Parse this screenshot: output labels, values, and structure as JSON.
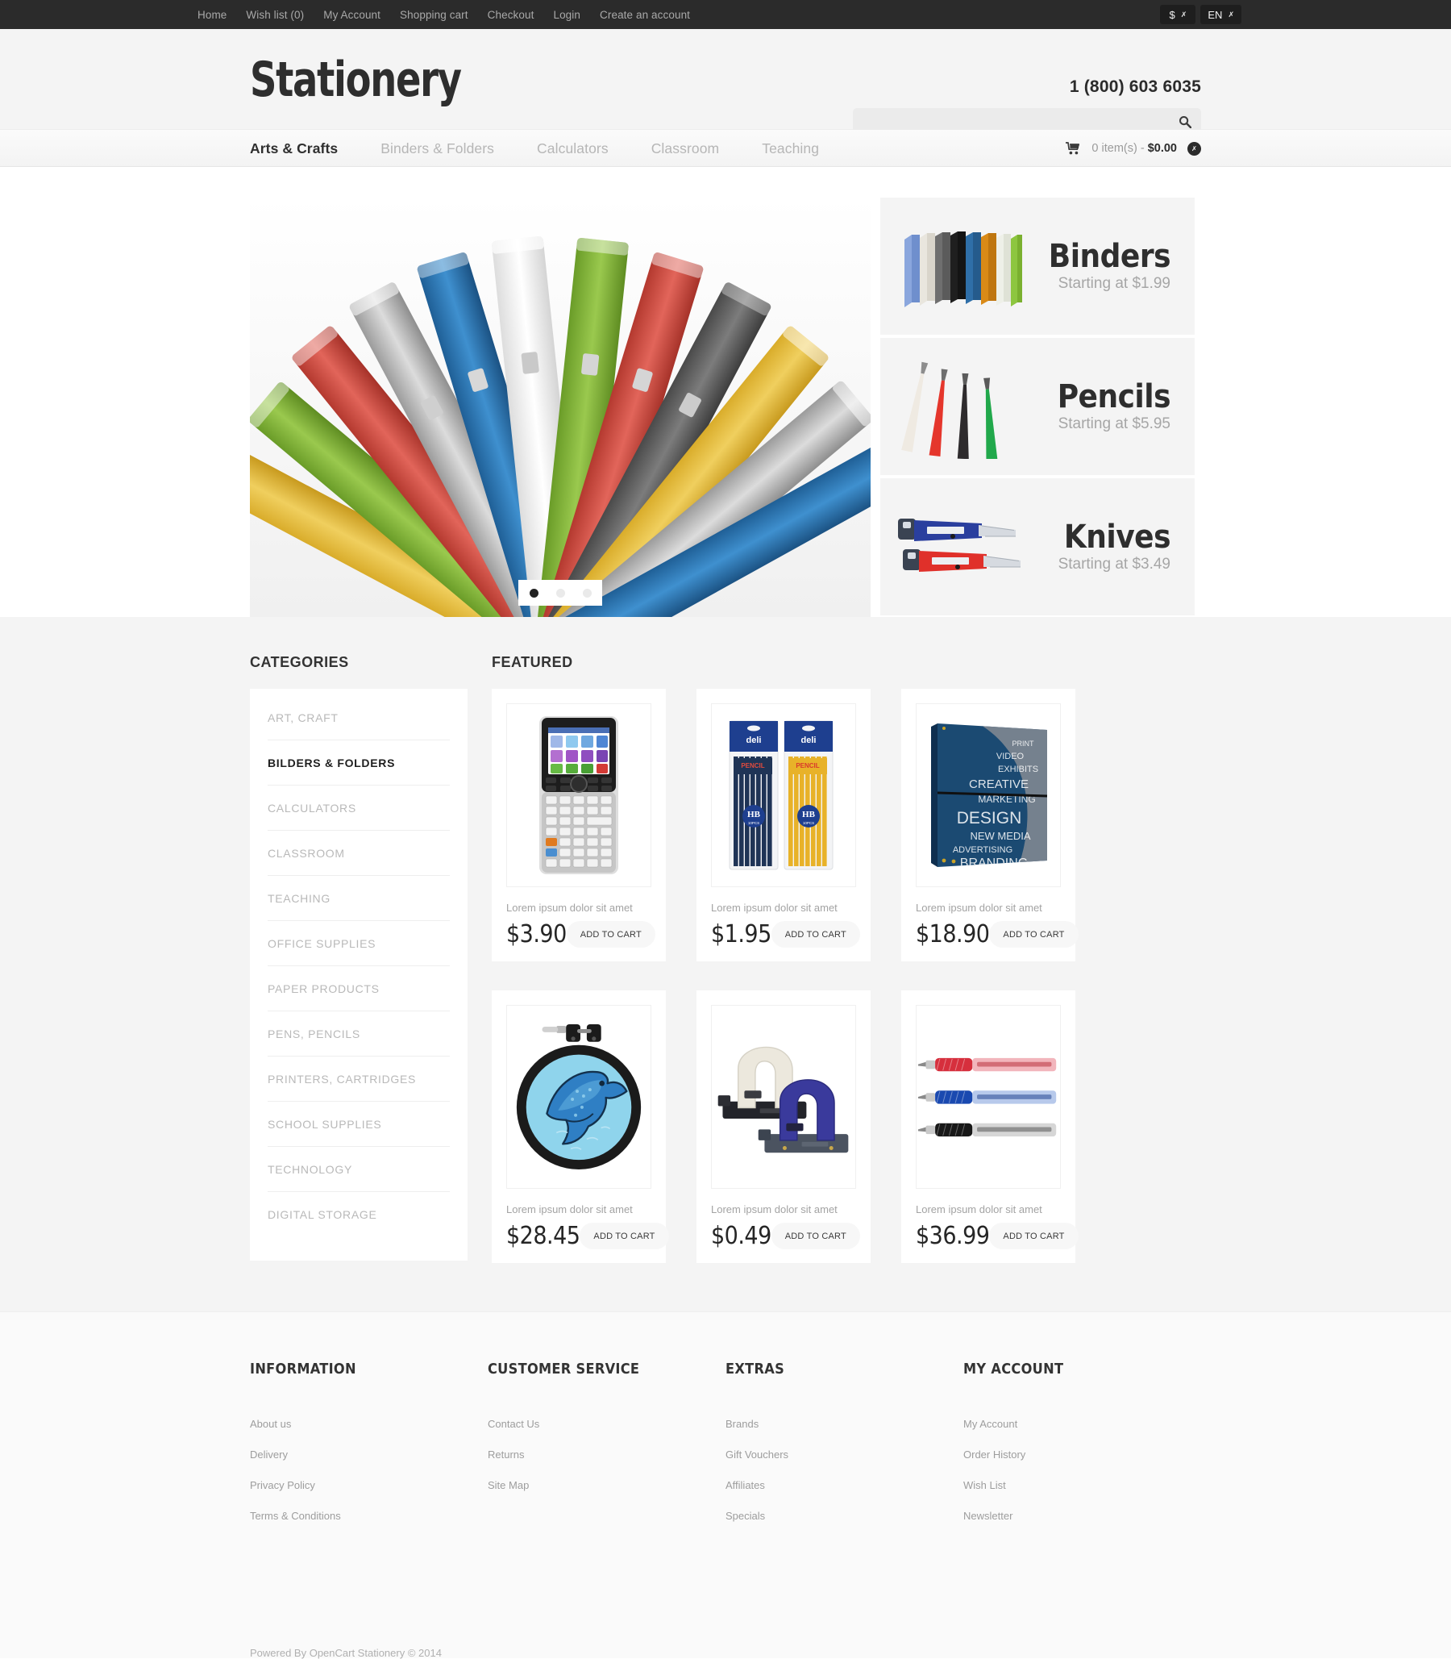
{
  "topbar": {
    "links": [
      {
        "label": "Home"
      },
      {
        "label": "Wish list (0)"
      },
      {
        "label": "My Account"
      },
      {
        "label": "Shopping cart"
      },
      {
        "label": "Checkout"
      },
      {
        "label": "Login"
      },
      {
        "label": "Create an account"
      }
    ],
    "currency": {
      "label": "$",
      "icon": "chevron-down-icon"
    },
    "language": {
      "label": "EN",
      "icon": "chevron-down-icon"
    }
  },
  "header": {
    "logo": "Stationery",
    "phone": "1 (800) 603 6035",
    "search": {
      "value": "",
      "placeholder": "",
      "icon": "search-icon"
    }
  },
  "nav": {
    "items": [
      {
        "label": "Arts & Crafts",
        "active": true
      },
      {
        "label": "Binders & Folders",
        "active": false
      },
      {
        "label": "Calculators",
        "active": false
      },
      {
        "label": "Classroom",
        "active": false
      },
      {
        "label": "Teaching",
        "active": false
      }
    ],
    "cart": {
      "icon": "shopping-cart-icon",
      "items_label": "0 item(s) - ",
      "total": "$0.00",
      "badge_icon": "chevron-down-icon"
    }
  },
  "hero": {
    "slider": {
      "alt": "colorful ring binders fanned out",
      "dots": [
        {
          "active": true
        },
        {
          "active": false
        },
        {
          "active": false
        }
      ]
    },
    "banners": [
      {
        "title": "Binders",
        "subtitle": "Starting at $1.99",
        "art": "binders"
      },
      {
        "title": "Pencils",
        "subtitle": "Starting at $5.95",
        "art": "pencils"
      },
      {
        "title": "Knives",
        "subtitle": "Starting at $3.49",
        "art": "knives"
      }
    ]
  },
  "sidebar": {
    "title": "Categories",
    "items": [
      {
        "label": "Art, Craft",
        "active": false
      },
      {
        "label": "Bilders & Folders",
        "active": true
      },
      {
        "label": "Calculators",
        "active": false
      },
      {
        "label": "Classroom",
        "active": false
      },
      {
        "label": "Teaching",
        "active": false
      },
      {
        "label": "Office Supplies",
        "active": false
      },
      {
        "label": "Paper Products",
        "active": false
      },
      {
        "label": "Pens, Pencils",
        "active": false
      },
      {
        "label": "Printers, Cartridges",
        "active": false
      },
      {
        "label": "School Supplies",
        "active": false
      },
      {
        "label": "Technology",
        "active": false
      },
      {
        "label": "Digital Storage",
        "active": false
      }
    ]
  },
  "featured": {
    "title": "Featured",
    "add_to_cart_label": "ADD TO CART",
    "products": [
      {
        "name": "Lorem ipsum dolor sit amet",
        "price": "$3.90",
        "art": "calculator"
      },
      {
        "name": "Lorem ipsum dolor sit amet",
        "price": "$1.95",
        "art": "pencilpacks"
      },
      {
        "name": "Lorem ipsum dolor sit amet",
        "price": "$18.90",
        "art": "printedbinder"
      },
      {
        "name": "Lorem ipsum dolor sit amet",
        "price": "$28.45",
        "art": "dolphinhoop"
      },
      {
        "name": "Lorem ipsum dolor sit amet",
        "price": "$0.49",
        "art": "holepunch"
      },
      {
        "name": "Lorem ipsum dolor sit amet",
        "price": "$36.99",
        "art": "pens"
      }
    ]
  },
  "footer": {
    "columns": [
      {
        "title": "Information",
        "links": [
          {
            "label": "About us"
          },
          {
            "label": "Delivery"
          },
          {
            "label": "Privacy Policy"
          },
          {
            "label": "Terms & Conditions"
          }
        ]
      },
      {
        "title": "Customer Service",
        "links": [
          {
            "label": "Contact Us"
          },
          {
            "label": "Returns"
          },
          {
            "label": "Site Map"
          }
        ]
      },
      {
        "title": "Extras",
        "links": [
          {
            "label": "Brands"
          },
          {
            "label": "Gift Vouchers"
          },
          {
            "label": "Affiliates"
          },
          {
            "label": "Specials"
          }
        ]
      },
      {
        "title": "My Account",
        "links": [
          {
            "label": "My Account"
          },
          {
            "label": "Order History"
          },
          {
            "label": "Wish List"
          },
          {
            "label": "Newsletter"
          }
        ]
      }
    ],
    "copyright": "Powered By OpenCart Stationery © 2014"
  },
  "colors": {
    "topbar_bg": "#2b2b2b",
    "header_bg": "#f4f4f4",
    "content_bg": "#f4f4f4",
    "card_bg": "#ffffff",
    "accent_text": "#2e2e2e",
    "muted_text": "#b9b9b9"
  }
}
